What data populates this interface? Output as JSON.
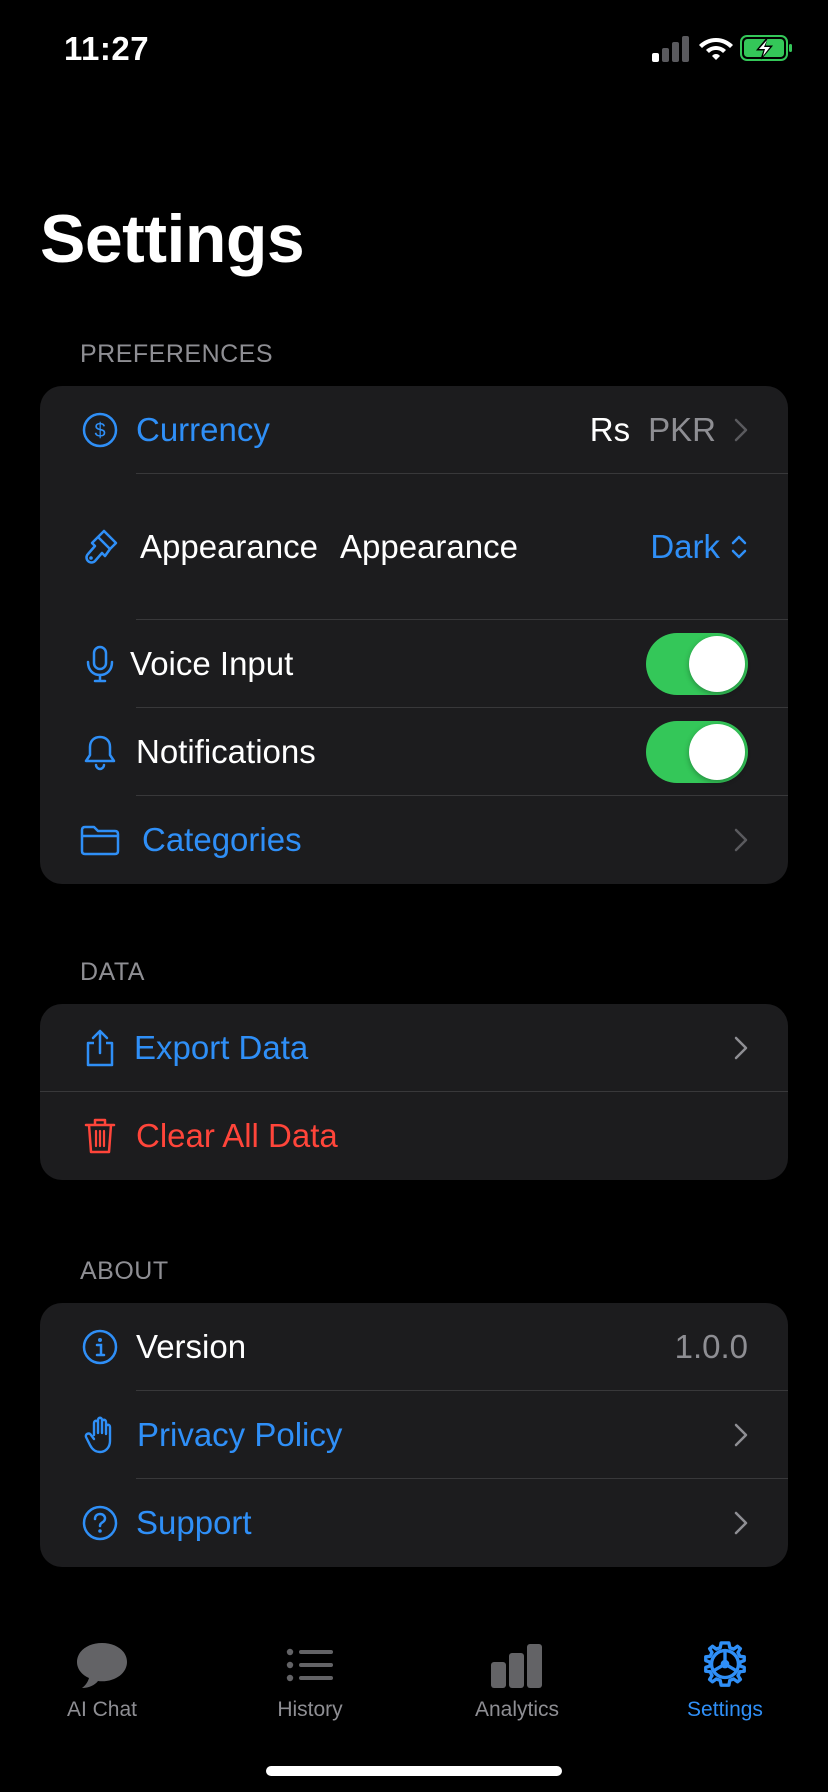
{
  "status_bar": {
    "time": "11:27"
  },
  "page": {
    "title": "Settings"
  },
  "sections": {
    "preferences": {
      "header": "PREFERENCES",
      "currency": {
        "label": "Currency",
        "symbol": "Rs",
        "code": "PKR"
      },
      "appearance": {
        "label": "Appearance",
        "picker_label": "Appearance",
        "value": "Dark"
      },
      "voice_input": {
        "label": "Voice Input",
        "enabled": true
      },
      "notifications": {
        "label": "Notifications",
        "enabled": true
      },
      "categories": {
        "label": "Categories"
      }
    },
    "data": {
      "header": "DATA",
      "export": {
        "label": "Export Data"
      },
      "clear": {
        "label": "Clear All Data"
      }
    },
    "about": {
      "header": "ABOUT",
      "version": {
        "label": "Version",
        "value": "1.0.0"
      },
      "privacy": {
        "label": "Privacy Policy"
      },
      "support": {
        "label": "Support"
      }
    }
  },
  "tab_bar": {
    "tabs": [
      {
        "label": "AI Chat",
        "icon": "chat-bubble-icon",
        "active": false
      },
      {
        "label": "History",
        "icon": "list-icon",
        "active": false
      },
      {
        "label": "Analytics",
        "icon": "bar-chart-icon",
        "active": false
      },
      {
        "label": "Settings",
        "icon": "gear-icon",
        "active": true
      }
    ]
  },
  "colors": {
    "accent": "#2f8ff7",
    "destructive": "#ff453a",
    "toggle_on": "#34c759",
    "card": "#1c1c1e",
    "background": "#000000"
  }
}
